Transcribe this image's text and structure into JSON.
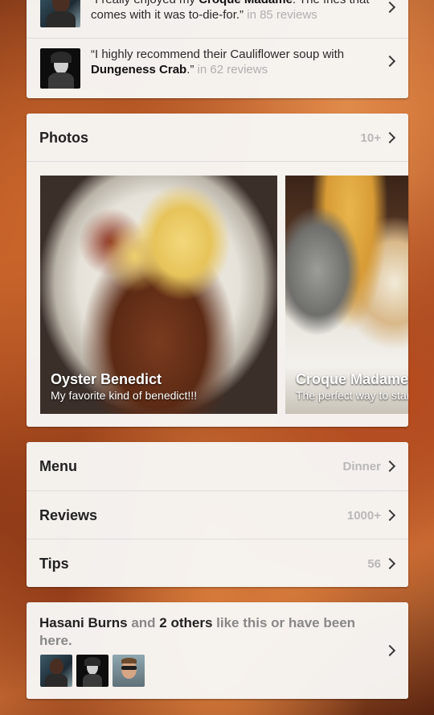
{
  "tips": [
    {
      "prefix": "“I really enjoyed my ",
      "bold": "Croque Madame",
      "suffix": ". The fries that comes with it was to-die-for.”",
      "count": "in 85 reviews"
    },
    {
      "prefix": "“I highly recommend their Cauliflower soup with ",
      "bold": "Dungeness Crab",
      "suffix": ".”",
      "count": "in 62 reviews"
    }
  ],
  "photos": {
    "title": "Photos",
    "count": "10+",
    "items": [
      {
        "title": "Oyster Benedict",
        "subtitle": "My favorite kind of benedict!!!"
      },
      {
        "title": "Croque Madame",
        "subtitle": "The perfect way to start t"
      }
    ]
  },
  "nav": [
    {
      "label": "Menu",
      "value": "Dinner"
    },
    {
      "label": "Reviews",
      "value": "1000+"
    },
    {
      "label": "Tips",
      "value": "56"
    }
  ],
  "likes": {
    "name": "Hasani Burns",
    "and": " and ",
    "others": "2 others",
    "tail": " like this or have been here."
  }
}
